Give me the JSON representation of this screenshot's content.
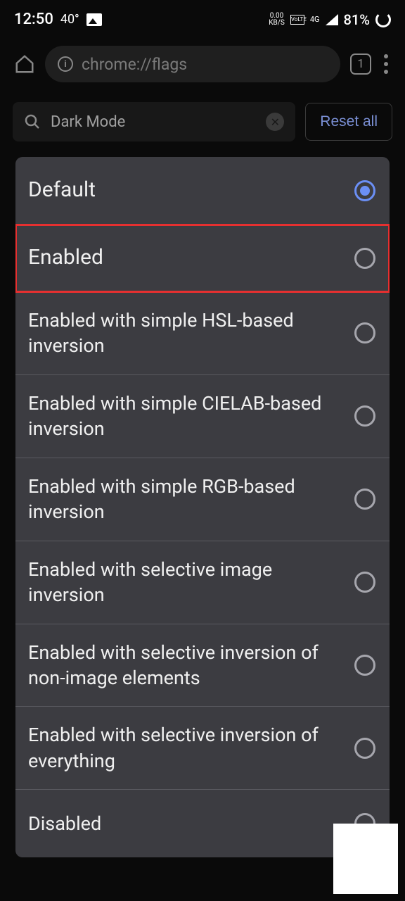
{
  "status": {
    "time": "12:50",
    "temp": "40°",
    "data_speed_top": "0.00",
    "data_speed_bottom": "KB/S",
    "volte": "VoLTE",
    "net": "4G",
    "battery": "81%"
  },
  "browser": {
    "url": "chrome://flags",
    "tab_count": "1"
  },
  "flags": {
    "search_value": "Dark Mode",
    "reset_label": "Reset all"
  },
  "options": [
    {
      "label": "Default",
      "selected": true,
      "highlighted": false,
      "cls": "default-row"
    },
    {
      "label": "Enabled",
      "selected": false,
      "highlighted": true,
      "cls": "enabled-row"
    },
    {
      "label": "Enabled with simple HSL-based inversion",
      "selected": false,
      "highlighted": false,
      "cls": ""
    },
    {
      "label": "Enabled with simple CIELAB-based inversion",
      "selected": false,
      "highlighted": false,
      "cls": ""
    },
    {
      "label": "Enabled with simple RGB-based inversion",
      "selected": false,
      "highlighted": false,
      "cls": ""
    },
    {
      "label": "Enabled with selective image inversion",
      "selected": false,
      "highlighted": false,
      "cls": ""
    },
    {
      "label": "Enabled with selective inversion of non-image elements",
      "selected": false,
      "highlighted": false,
      "cls": ""
    },
    {
      "label": "Enabled with selective inversion of everything",
      "selected": false,
      "highlighted": false,
      "cls": ""
    },
    {
      "label": "Disabled",
      "selected": false,
      "highlighted": false,
      "cls": ""
    }
  ]
}
